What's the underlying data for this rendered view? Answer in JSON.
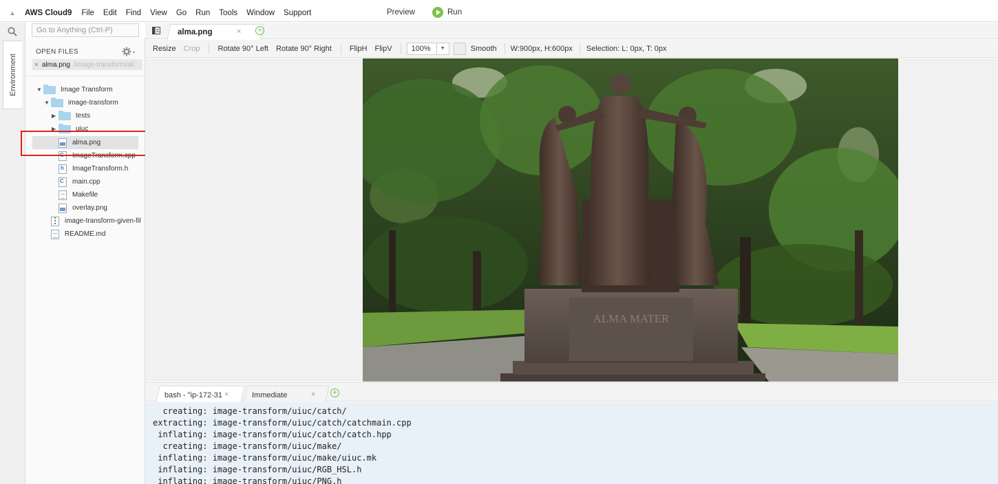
{
  "menubar": {
    "brand": "AWS Cloud9",
    "items": [
      "File",
      "Edit",
      "Find",
      "View",
      "Go",
      "Run",
      "Tools",
      "Window",
      "Support"
    ],
    "preview": "Preview",
    "run": "Run"
  },
  "sidebar": {
    "environment_tab": "Environment",
    "goto_placeholder": "Go to Anything (Ctrl-P)",
    "open_files_title": "OPEN FILES",
    "open_file": {
      "name": "alma.png",
      "path": "/image-transform/ali"
    },
    "tree": [
      {
        "label": "Image Transform",
        "type": "folder",
        "expanded": true
      },
      {
        "label": "image-transform",
        "type": "folder",
        "expanded": true
      },
      {
        "label": "tests",
        "type": "folder",
        "expanded": false
      },
      {
        "label": "uiuc",
        "type": "folder",
        "expanded": false
      },
      {
        "label": "alma.png",
        "type": "image",
        "selected": true
      },
      {
        "label": "ImageTransform.cpp",
        "type": "cpp"
      },
      {
        "label": "ImageTransform.h",
        "type": "h"
      },
      {
        "label": "main.cpp",
        "type": "cpp"
      },
      {
        "label": "Makefile",
        "type": "txt"
      },
      {
        "label": "overlay.png",
        "type": "image"
      },
      {
        "label": "image-transform-given-fil",
        "type": "zip"
      },
      {
        "label": "README.md",
        "type": "txt"
      }
    ]
  },
  "editor": {
    "tab_label": "alma.png",
    "tab_close": "×",
    "tab_add": "+"
  },
  "toolbar": {
    "resize": "Resize",
    "crop": "Crop",
    "rotate_left": "Rotate 90° Left",
    "rotate_right": "Rotate 90° Right",
    "fliph": "FlipH",
    "flipv": "FlipV",
    "zoom": "100%",
    "smooth": "Smooth",
    "dimensions": "W:900px, H:600px",
    "selection": "Selection:  L: 0px, T: 0px"
  },
  "image": {
    "engraving": "ALMA MATER"
  },
  "terminal": {
    "tab1": "bash - \"ip-172-31",
    "tab1_close": "×",
    "tab2": "Immediate",
    "tab2_close": "×",
    "add": "+",
    "lines": [
      "  creating: image-transform/uiuc/catch/",
      "extracting: image-transform/uiuc/catch/catchmain.cpp",
      " inflating: image-transform/uiuc/catch/catch.hpp",
      "  creating: image-transform/uiuc/make/",
      " inflating: image-transform/uiuc/make/uiuc.mk",
      " inflating: image-transform/uiuc/RGB_HSL.h",
      " inflating: image-transform/uiuc/PNG.h"
    ]
  },
  "colors": {
    "accent_green": "#7cc24e",
    "highlight_red": "#d9251d",
    "folder_blue": "#a9d4ee",
    "terminal_bg": "#e9f1f8"
  }
}
